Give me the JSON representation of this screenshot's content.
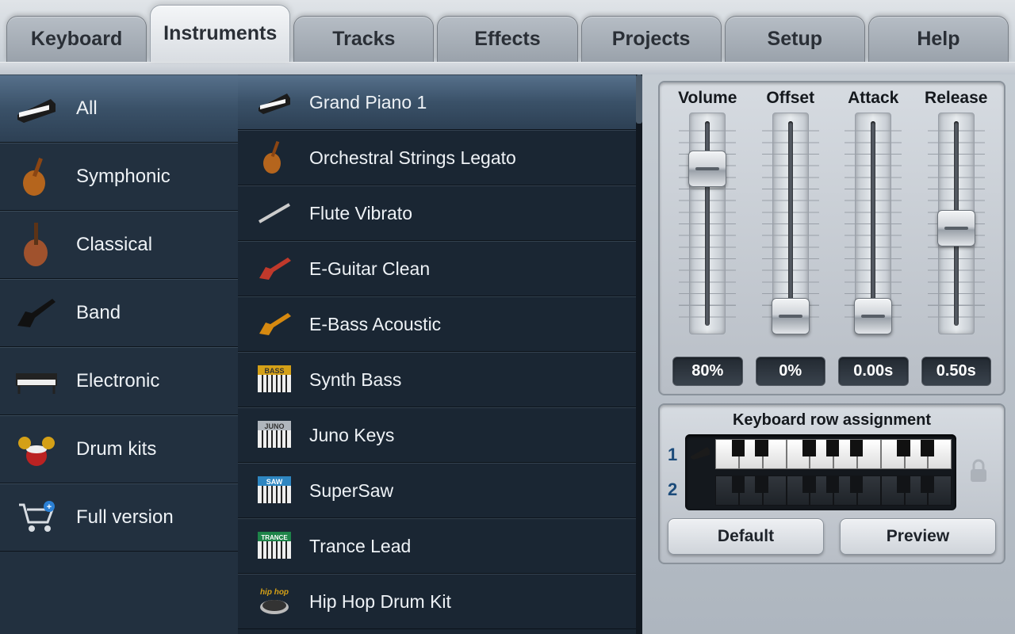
{
  "tabs": [
    {
      "label": "Keyboard",
      "active": false
    },
    {
      "label": "Instruments",
      "active": true
    },
    {
      "label": "Tracks",
      "active": false
    },
    {
      "label": "Effects",
      "active": false
    },
    {
      "label": "Projects",
      "active": false
    },
    {
      "label": "Setup",
      "active": false
    },
    {
      "label": "Help",
      "active": false
    }
  ],
  "categories": [
    {
      "label": "All",
      "icon": "piano",
      "selected": true
    },
    {
      "label": "Symphonic",
      "icon": "violin",
      "selected": false
    },
    {
      "label": "Classical",
      "icon": "cello",
      "selected": false
    },
    {
      "label": "Band",
      "icon": "eguitar-v",
      "selected": false
    },
    {
      "label": "Electronic",
      "icon": "keyboard",
      "selected": false
    },
    {
      "label": "Drum kits",
      "icon": "drums",
      "selected": false
    },
    {
      "label": "Full version",
      "icon": "cart",
      "selected": false
    }
  ],
  "instruments": [
    {
      "label": "Grand Piano 1",
      "icon": "piano",
      "selected": true
    },
    {
      "label": "Orchestral Strings Legato",
      "icon": "violin",
      "selected": false
    },
    {
      "label": "Flute Vibrato",
      "icon": "flute",
      "selected": false
    },
    {
      "label": "E-Guitar Clean",
      "icon": "eguitar",
      "selected": false
    },
    {
      "label": "E-Bass Acoustic",
      "icon": "bass",
      "selected": false
    },
    {
      "label": "Synth Bass",
      "icon": "synth-bass",
      "selected": false
    },
    {
      "label": "Juno Keys",
      "icon": "synth-juno",
      "selected": false
    },
    {
      "label": "SuperSaw",
      "icon": "synth-saw",
      "selected": false
    },
    {
      "label": "Trance Lead",
      "icon": "synth-trance",
      "selected": false
    },
    {
      "label": "Hip Hop Drum Kit",
      "icon": "turntable",
      "selected": false
    }
  ],
  "sliders": {
    "headers": [
      "Volume",
      "Offset",
      "Attack",
      "Release"
    ],
    "values": [
      "80%",
      "0%",
      "0.00s",
      "0.50s"
    ],
    "positions": [
      80,
      0,
      0,
      50
    ]
  },
  "assignment": {
    "title": "Keyboard row assignment",
    "rows": [
      "1",
      "2"
    ],
    "buttons": {
      "default": "Default",
      "preview": "Preview"
    }
  }
}
